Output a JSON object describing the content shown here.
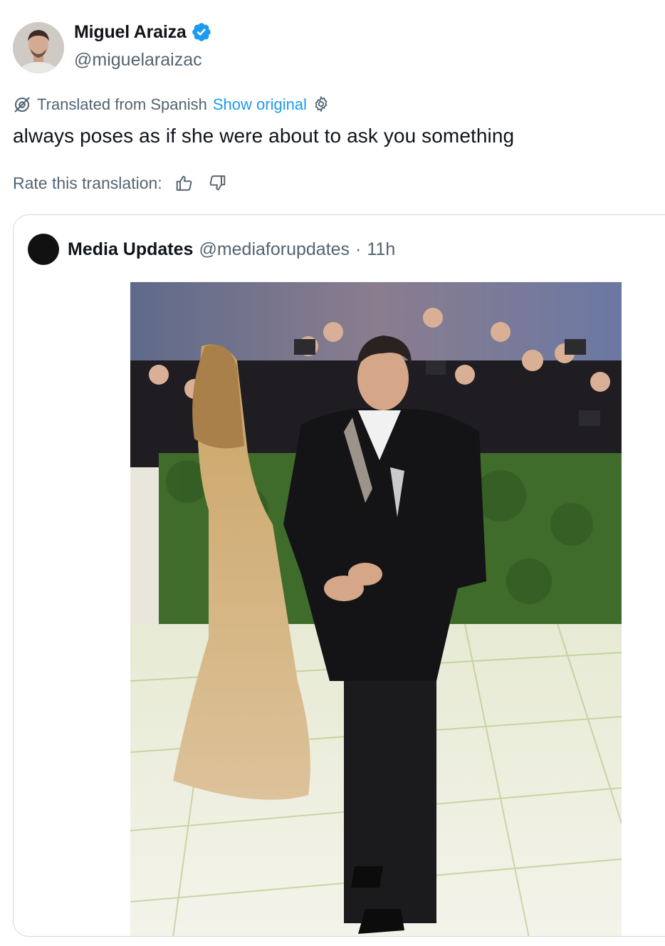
{
  "author": {
    "display_name": "Miguel Araiza",
    "handle": "@miguelaraizac",
    "avatar_icon": "avatar-photo",
    "verified_icon": "verified-badge-icon"
  },
  "translation": {
    "label": "Translated from Spanish",
    "show_original_label": "Show original",
    "settings_icon": "gear-icon"
  },
  "tweet": {
    "text": "always poses as if she were about to ask you something"
  },
  "rating": {
    "label": "Rate this translation:",
    "thumbs_up_icon": "thumbs-up-icon",
    "thumbs_down_icon": "thumbs-down-icon"
  },
  "quote": {
    "display_name": "Media Updates",
    "handle": "@mediaforupdates",
    "separator": "·",
    "time": "11h"
  },
  "colors": {
    "accent": "#1d9bf0",
    "secondary_text": "#536471",
    "primary_text": "#0f1419",
    "border": "#cfd9de"
  }
}
